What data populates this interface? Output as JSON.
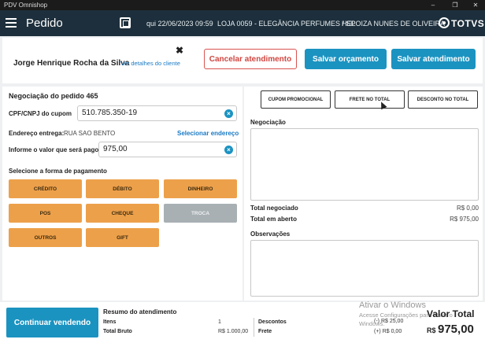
{
  "window": {
    "title": "PDV Omnishop",
    "controls": [
      "–",
      "❐",
      "✕"
    ]
  },
  "appbar": {
    "title": "Pedido",
    "datetime": "qui 22/06/2023 09:59",
    "store": "LOJA 0059 - ELEGÂNCIA PERFUMES / SP",
    "user": "HELOIZA NUNES DE OLIVEIRA",
    "brand": "TOTVS",
    "icons": [
      "menu-icon",
      "qrcode-icon",
      "totvs-logo-icon"
    ]
  },
  "customer": {
    "name": "Jorge Henrique Rocha da Silva",
    "details_link": "Ver detalhes do cliente",
    "close_glyph": "✖"
  },
  "actions": {
    "cancel": "Cancelar atendimento",
    "save_quote": "Salvar orçamento",
    "save_service": "Salvar atendimento"
  },
  "negotiation": {
    "title": "Negociação do pedido 465",
    "cpf_label": "CPF/CNPJ do cupom",
    "cpf_value": "510.785.350-19",
    "address_label": "Endereço entrega:",
    "address_value": "RUA SAO BENTO",
    "address_link": "Selecionar endereço",
    "amount_label": "Informe o valor que será pago",
    "amount_value": "975,00",
    "payment_title": "Selecione a forma de pagamento",
    "payment_methods": [
      "CRÉDITO",
      "DÉBITO",
      "DINHEIRO",
      "POS",
      "CHEQUE",
      "TROCA",
      "OUTROS",
      "GIFT"
    ]
  },
  "right": {
    "tabs": [
      "CUPOM PROMOCIONAL",
      "FRETE NO TOTAL",
      "DESCONTO NO TOTAL"
    ],
    "negociacao_label": "Negociação",
    "total_negociado_label": "Total negociado",
    "total_negociado_value": "R$ 0,00",
    "total_aberto_label": "Total em aberto",
    "total_aberto_value": "R$ 975,00",
    "observacoes_label": "Observações"
  },
  "footer": {
    "continue": "Continuar vendendo",
    "summary_title": "Resumo do atendimento",
    "itens_label": "Itens",
    "itens_value": "1",
    "total_bruto_label": "Total Bruto",
    "total_bruto_value": "R$ 1.000,00",
    "descontos_label": "Descontos",
    "descontos_value": "(-) R$ 25,00",
    "frete_label": "Frete",
    "frete_value": "(+) R$ 0,00",
    "valor_total_label": "Valor Total",
    "currency": "R$",
    "valor_total_value": "975,00"
  },
  "watermark": {
    "line1": "Ativar o Windows",
    "line2": "Acesse Configurações para ativar o",
    "line3": "Windows."
  },
  "colors": {
    "appbar": "#1d2f3c",
    "primary": "#1b93c1",
    "danger": "#d9534f",
    "payment": "#eda04a",
    "disabled": "#a8b0b4"
  }
}
